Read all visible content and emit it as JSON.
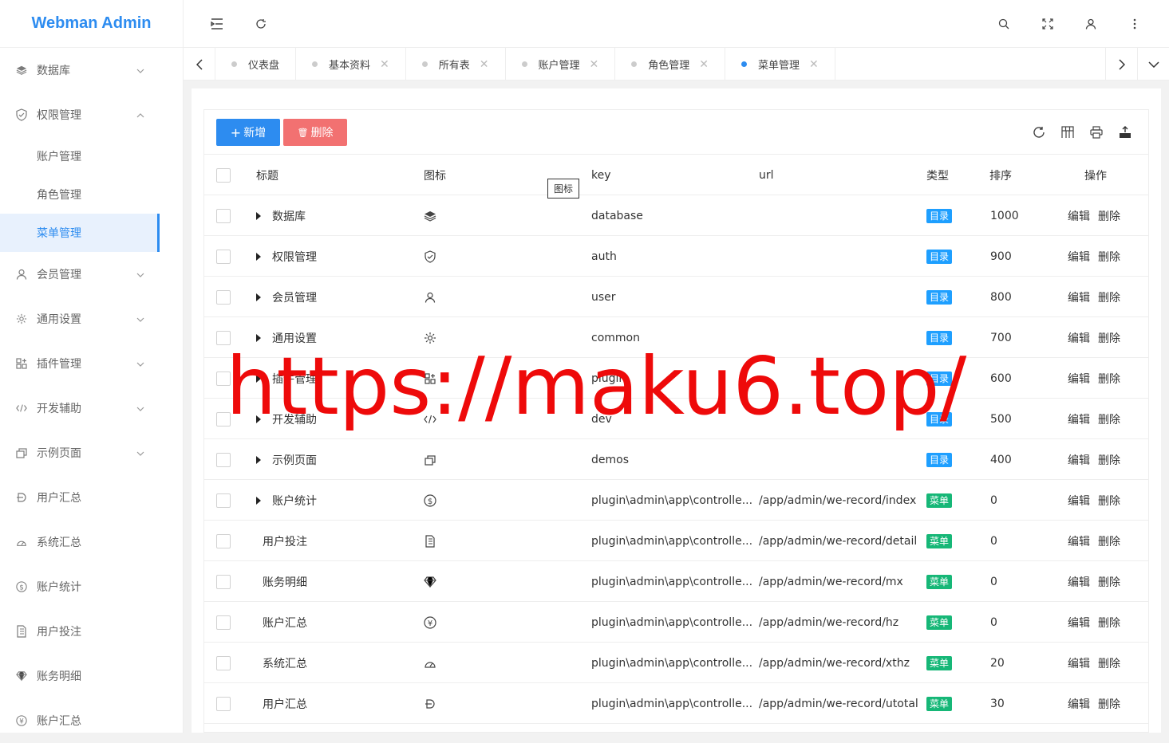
{
  "app_title": "Webman Admin",
  "sidebar": {
    "items": [
      {
        "label": "数据库",
        "icon": "layers-icon",
        "expand": "down"
      },
      {
        "label": "权限管理",
        "icon": "shield-icon",
        "expand": "up",
        "children": [
          {
            "label": "账户管理"
          },
          {
            "label": "角色管理"
          },
          {
            "label": "菜单管理",
            "active": true
          }
        ]
      },
      {
        "label": "会员管理",
        "icon": "user-icon",
        "expand": "down"
      },
      {
        "label": "通用设置",
        "icon": "gear-icon",
        "expand": "down"
      },
      {
        "label": "插件管理",
        "icon": "apps-icon",
        "expand": "down"
      },
      {
        "label": "开发辅助",
        "icon": "code-icon",
        "expand": "down"
      },
      {
        "label": "示例页面",
        "icon": "template-icon",
        "expand": "down"
      },
      {
        "label": "用户汇总",
        "icon": "currency-d-icon"
      },
      {
        "label": "系统汇总",
        "icon": "dashboard-icon"
      },
      {
        "label": "账户统计",
        "icon": "dollar-icon"
      },
      {
        "label": "用户投注",
        "icon": "receipt-icon"
      },
      {
        "label": "账务明细",
        "icon": "diamond-icon"
      },
      {
        "label": "账户汇总",
        "icon": "yen-icon"
      }
    ]
  },
  "tabs": [
    {
      "label": "仪表盘",
      "closable": false
    },
    {
      "label": "基本资料",
      "closable": true
    },
    {
      "label": "所有表",
      "closable": true
    },
    {
      "label": "账户管理",
      "closable": true
    },
    {
      "label": "角色管理",
      "closable": true
    },
    {
      "label": "菜单管理",
      "closable": true,
      "active": true
    }
  ],
  "toolbar": {
    "add_label": "新增",
    "delete_label": "删除"
  },
  "table": {
    "headers": {
      "title": "标题",
      "icon": "图标",
      "key": "key",
      "url": "url",
      "type": "类型",
      "sort": "排序",
      "ops": "操作"
    },
    "tooltip": "图标",
    "op_edit": "编辑",
    "op_delete": "删除",
    "rows": [
      {
        "title": "数据库",
        "expandable": true,
        "icon": "layers-icon",
        "key": "database",
        "url": "",
        "type": "目录",
        "sort": "1000"
      },
      {
        "title": "权限管理",
        "expandable": true,
        "icon": "shield-icon",
        "key": "auth",
        "url": "",
        "type": "目录",
        "sort": "900"
      },
      {
        "title": "会员管理",
        "expandable": true,
        "icon": "user-icon",
        "key": "user",
        "url": "",
        "type": "目录",
        "sort": "800"
      },
      {
        "title": "通用设置",
        "expandable": true,
        "icon": "gear-icon",
        "key": "common",
        "url": "",
        "type": "目录",
        "sort": "700"
      },
      {
        "title": "插件管理",
        "expandable": true,
        "icon": "apps-icon",
        "key": "plugin",
        "url": "",
        "type": "目录",
        "sort": "600"
      },
      {
        "title": "开发辅助",
        "expandable": true,
        "icon": "code-icon",
        "key": "dev",
        "url": "",
        "type": "目录",
        "sort": "500"
      },
      {
        "title": "示例页面",
        "expandable": true,
        "icon": "template-icon",
        "key": "demos",
        "url": "",
        "type": "目录",
        "sort": "400"
      },
      {
        "title": "账户统计",
        "expandable": true,
        "icon": "dollar-icon",
        "key": "plugin\\admin\\app\\controlle...",
        "url": "/app/admin/we-record/index",
        "type": "菜单",
        "sort": "0"
      },
      {
        "title": "用户投注",
        "expandable": false,
        "icon": "receipt-icon",
        "key": "plugin\\admin\\app\\controlle...",
        "url": "/app/admin/we-record/detail",
        "type": "菜单",
        "sort": "0"
      },
      {
        "title": "账务明细",
        "expandable": false,
        "icon": "diamond-icon",
        "key": "plugin\\admin\\app\\controlle...",
        "url": "/app/admin/we-record/mx",
        "type": "菜单",
        "sort": "0"
      },
      {
        "title": "账户汇总",
        "expandable": false,
        "icon": "yen-icon",
        "key": "plugin\\admin\\app\\controlle...",
        "url": "/app/admin/we-record/hz",
        "type": "菜单",
        "sort": "0"
      },
      {
        "title": "系统汇总",
        "expandable": false,
        "icon": "dashboard-icon",
        "key": "plugin\\admin\\app\\controlle...",
        "url": "/app/admin/we-record/xthz",
        "type": "菜单",
        "sort": "20"
      },
      {
        "title": "用户汇总",
        "expandable": false,
        "icon": "currency-d-icon",
        "key": "plugin\\admin\\app\\controlle...",
        "url": "/app/admin/we-record/utotal",
        "type": "菜单",
        "sort": "30"
      }
    ]
  },
  "watermark": "https://maku6.top/",
  "colors": {
    "primary": "#2d8cf0",
    "danger": "#f27171",
    "badge_dir": "#1e9fff",
    "badge_menu": "#16b777",
    "watermark": "#ee0a0a"
  }
}
